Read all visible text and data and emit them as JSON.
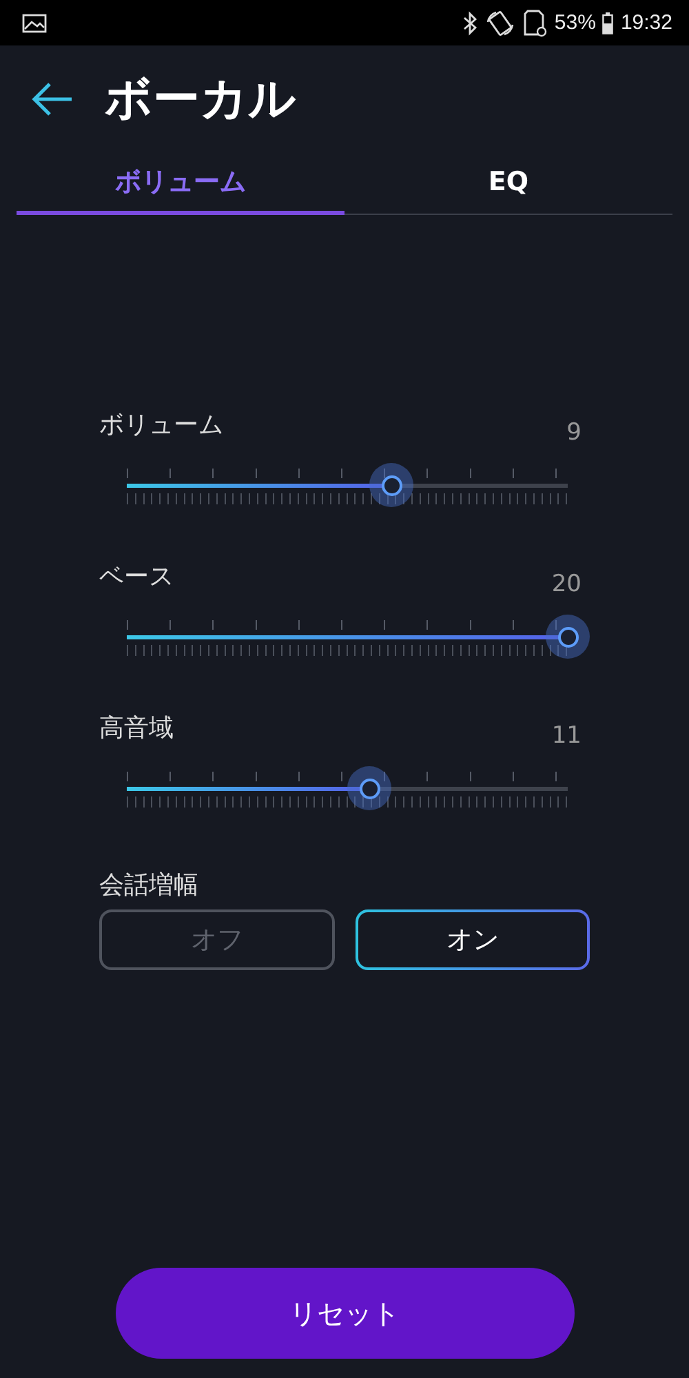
{
  "status_bar": {
    "battery": "53%",
    "time": "19:32"
  },
  "header": {
    "title": "ボーカル"
  },
  "tabs": [
    {
      "label": "ボリューム",
      "selected": true
    },
    {
      "label": "EQ",
      "selected": false
    }
  ],
  "sliders": [
    {
      "label": "ボリューム",
      "value": "9",
      "level": 0.6
    },
    {
      "label": "ベース",
      "value": "20",
      "level": 1.0
    },
    {
      "label": "高音域",
      "value": "11",
      "level": 0.55
    }
  ],
  "dialog_boost": {
    "label": "会話増幅",
    "options": [
      {
        "label": "オフ",
        "selected": false
      },
      {
        "label": "オン",
        "selected": true
      }
    ]
  },
  "reset_button": "リセット"
}
